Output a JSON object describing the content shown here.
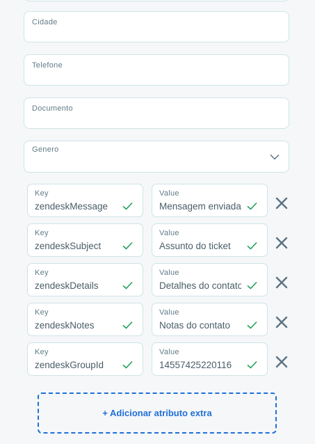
{
  "fields": [
    {
      "label": "Cidade",
      "value": ""
    },
    {
      "label": "Telefone",
      "value": ""
    },
    {
      "label": "Documento",
      "value": ""
    },
    {
      "label": "Genero",
      "value": ""
    }
  ],
  "attributes": {
    "key_label": "Key",
    "value_label": "Value",
    "items": [
      {
        "key": "zendeskMessage",
        "value": "Mensagem enviada"
      },
      {
        "key": "zendeskSubject",
        "value": "Assunto do ticket"
      },
      {
        "key": "zendeskDetails",
        "value": "Detalhes do contato"
      },
      {
        "key": "zendeskNotes",
        "value": "Notas do contato"
      },
      {
        "key": "zendeskGroupId",
        "value": "14557425220116"
      }
    ]
  },
  "add_button": {
    "label": "+ Adicionar atributo extra"
  },
  "colors": {
    "accent": "#1f6fd6",
    "valid": "#22a05a",
    "border": "#cfe3e6",
    "remove": "#5c7283"
  }
}
